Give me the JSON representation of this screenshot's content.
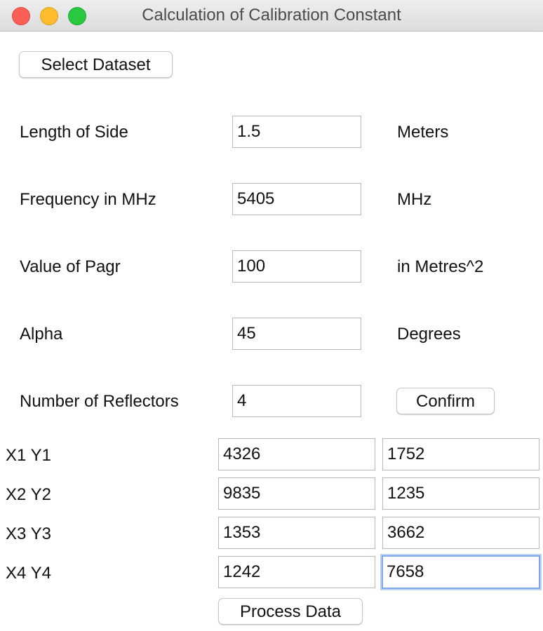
{
  "window": {
    "title": "Calculation of Calibration Constant"
  },
  "buttons": {
    "select_dataset": "Select Dataset",
    "confirm": "Confirm",
    "process_data": "Process Data"
  },
  "params": {
    "length": {
      "label": "Length of Side",
      "value": "1.5",
      "unit": "Meters"
    },
    "frequency": {
      "label": "Frequency in MHz",
      "value": "5405",
      "unit": "MHz"
    },
    "pagr": {
      "label": "Value of Pagr",
      "value": "100",
      "unit": "in Metres^2"
    },
    "alpha": {
      "label": "Alpha",
      "value": "45",
      "unit": "Degrees"
    },
    "reflectors": {
      "label": "Number of Reflectors",
      "value": "4"
    }
  },
  "points": [
    {
      "label": "X1 Y1",
      "x": "4326",
      "y": "1752"
    },
    {
      "label": "X2 Y2",
      "x": "9835",
      "y": "1235"
    },
    {
      "label": "X3 Y3",
      "x": "1353",
      "y": "3662"
    },
    {
      "label": "X4 Y4",
      "x": "1242",
      "y": "7658"
    }
  ]
}
